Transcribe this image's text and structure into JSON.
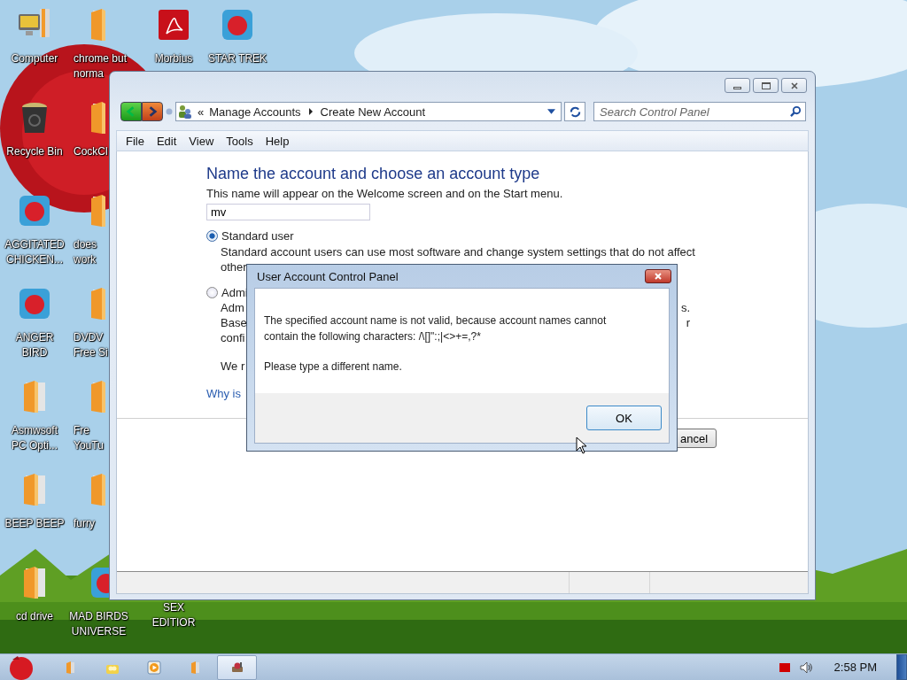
{
  "desktop_columns": [
    [
      {
        "lines": [
          "Computer"
        ],
        "kind": "computer",
        "cut": false
      },
      {
        "lines": [
          "Recycle Bin"
        ],
        "kind": "bin",
        "cut": false
      },
      {
        "lines": [
          "AGGITATED",
          "CHICKEN..."
        ],
        "kind": "app",
        "cut": false
      },
      {
        "lines": [
          "ANGER",
          "BIRD"
        ],
        "kind": "app",
        "cut": false
      },
      {
        "lines": [
          "Asmwsoft",
          "PC Opti..."
        ],
        "kind": "folder",
        "cut": false
      },
      {
        "lines": [
          "BEEP BEEP"
        ],
        "kind": "folder",
        "cut": false
      },
      {
        "lines": [
          "cd drive"
        ],
        "kind": "folder",
        "cut": false
      }
    ],
    [
      {
        "lines": [
          "chrome but",
          "norma"
        ],
        "kind": "folder",
        "cut": true
      },
      {
        "lines": [
          "CockCl"
        ],
        "kind": "folder",
        "cut": true
      },
      {
        "lines": [
          "does",
          "work"
        ],
        "kind": "folder",
        "cut": true
      },
      {
        "lines": [
          "DVDV",
          "Free Si"
        ],
        "kind": "folder",
        "cut": true
      },
      {
        "lines": [
          "Fre",
          "YouTu"
        ],
        "kind": "folder",
        "cut": true
      },
      {
        "lines": [
          "furry"
        ],
        "kind": "folder",
        "cut": true
      },
      {
        "lines": [
          "MAD BIRDS",
          "UNIVERSE"
        ],
        "kind": "app",
        "cut": false
      }
    ],
    [
      {
        "lines": [
          "Morbius"
        ],
        "kind": "document",
        "cut": false
      },
      {
        "lines": [
          "SEX",
          "EDITIOR"
        ],
        "kind": "none",
        "cut": false
      }
    ],
    [
      {
        "lines": [
          "STAR TREK"
        ],
        "kind": "app",
        "cut": false
      }
    ]
  ],
  "window": {
    "breadcrumb": [
      "Manage Accounts",
      "Create New Account"
    ],
    "breadcrumb_prefix": "«",
    "search": {
      "placeholder": "Search Control Panel"
    },
    "menu": [
      "File",
      "Edit",
      "View",
      "Tools",
      "Help"
    ],
    "heading": "Name the account and choose an account type",
    "subtitle": "This name will appear on the Welcome screen and on the Start menu.",
    "name_field": {
      "value": "mv"
    },
    "radios": [
      {
        "label": "Standard user",
        "selected": true
      },
      {
        "label": "Admi",
        "selected": false
      }
    ],
    "standard_description": "Standard account users can use most software and change system settings that do not affect",
    "fragments_standard": [
      {
        "left": "other"
      }
    ],
    "fragments_admin": [
      {
        "left": "Adm",
        "right": "s."
      },
      {
        "left": "Base",
        "right": "r"
      },
      {
        "left": "confi"
      }
    ],
    "note_fragment": "We r",
    "link": "Why is",
    "cancel_button": "ancel"
  },
  "dialog": {
    "title": "User Account Control Panel",
    "message_lines": [
      "The specified account name is not valid, because account names cannot",
      "contain the following characters: /\\[]\":;|<>+=,?*"
    ],
    "prompt": "Please type a different name.",
    "ok_button": "OK"
  },
  "taskbar": {
    "items": [
      {
        "kind": "folder",
        "selected": false
      },
      {
        "kind": "people",
        "selected": false
      },
      {
        "kind": "media",
        "selected": false
      },
      {
        "kind": "folder",
        "selected": false
      },
      {
        "kind": "app",
        "selected": true
      }
    ],
    "clock": "2:58 PM"
  }
}
